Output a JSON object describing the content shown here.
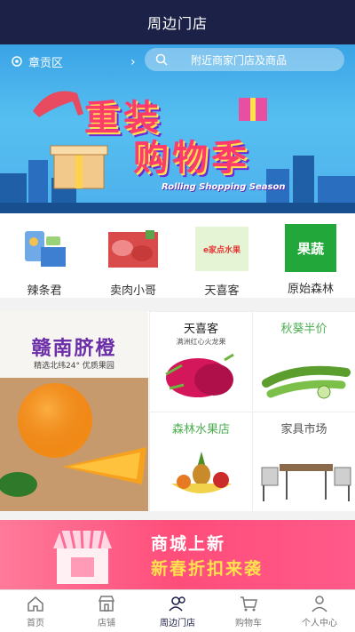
{
  "header": {
    "title": "周边门店"
  },
  "banner": {
    "location": "章贡区",
    "location_arrow": "›",
    "search_placeholder": "附近商家门店及商品",
    "headline_line1": "重装",
    "headline_line2": "购物季",
    "subtitle": "Rolling Shopping Season"
  },
  "categories": [
    {
      "label": "辣条君",
      "icon": "spicy-strips-icon"
    },
    {
      "label": "卖肉小哥",
      "icon": "meat-icon"
    },
    {
      "label": "天喜客",
      "icon": "fruit-shop-icon",
      "badge": "e家点水果"
    },
    {
      "label": "原始森林",
      "icon": "produce-icon",
      "badge": "果蔬"
    }
  ],
  "promo": {
    "feature": {
      "title": "赣南脐橙",
      "subtitle": "精选北纬24° 优质果园"
    },
    "tiles": [
      {
        "title": "天喜客",
        "subtitle": "满洲红心火龙果",
        "title_color": "#222222"
      },
      {
        "title": "秋葵半价",
        "subtitle": "",
        "title_color": "#4caf50"
      },
      {
        "title": "森林水果店",
        "subtitle": "",
        "title_color": "#4caf50"
      },
      {
        "title": "家具市场",
        "subtitle": "",
        "title_color": "#555555"
      }
    ]
  },
  "bottom_banner": {
    "line1": "商城上新",
    "line2": "新春折扣来袭"
  },
  "tabbar": [
    {
      "label": "首页",
      "icon": "home-icon",
      "active": false
    },
    {
      "label": "店铺",
      "icon": "store-icon",
      "active": false
    },
    {
      "label": "周边门店",
      "icon": "nearby-icon",
      "active": true
    },
    {
      "label": "购物车",
      "icon": "cart-icon",
      "active": false
    },
    {
      "label": "个人中心",
      "icon": "profile-icon",
      "active": false
    }
  ],
  "colors": {
    "header_bg": "#1c2147",
    "accent": "#ff3b6b",
    "active_tab": "#1c2147"
  }
}
